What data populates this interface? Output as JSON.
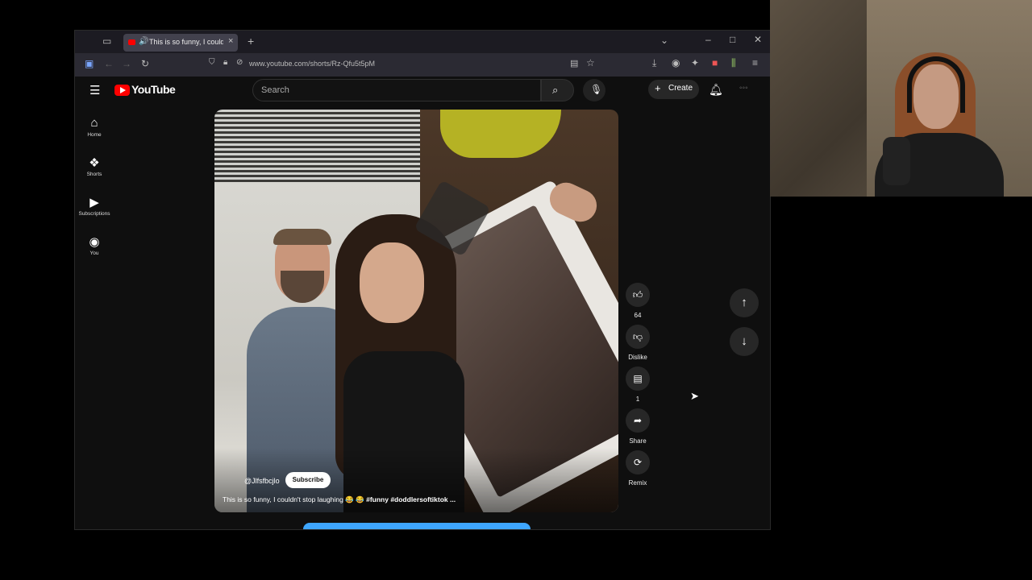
{
  "browser": {
    "tab_title": "This is so funny, I couldn't stop laughing",
    "url": "www.youtube.com/shorts/Rz-Qfu5t5pM",
    "new_tab": "+",
    "tab_close": "×"
  },
  "youtube": {
    "logo_text": "YouTube",
    "search_placeholder": "Search",
    "create_label": "Create",
    "sidebar": [
      {
        "label": "Home",
        "icon": "home-icon"
      },
      {
        "label": "Shorts",
        "icon": "shorts-icon"
      },
      {
        "label": "Subscriptions",
        "icon": "subscriptions-icon"
      },
      {
        "label": "You",
        "icon": "you-icon"
      }
    ]
  },
  "short": {
    "channel": "@Jlfsfbcjlo",
    "subscribe_label": "Subscribe",
    "caption_text": "This is so funny, I couldn't stop laughing 😂 😂 ",
    "caption_tags": "#funny #doddlersoftiktok ...",
    "actions": {
      "likes": "64",
      "dislike": "Dislike",
      "comments": "1",
      "share": "Share",
      "remix": "Remix"
    }
  },
  "colors": {
    "brand_red": "#ff0000",
    "background": "#0f0f0f",
    "accent_blue": "#3ea6ff"
  }
}
